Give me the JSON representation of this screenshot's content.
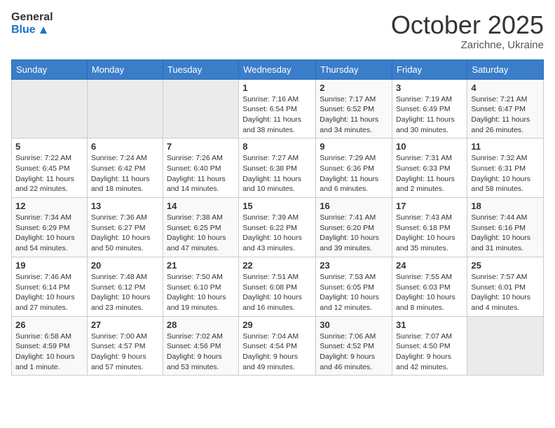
{
  "header": {
    "logo_line1": "General",
    "logo_line2": "Blue",
    "month": "October 2025",
    "location": "Zarichne, Ukraine"
  },
  "weekdays": [
    "Sunday",
    "Monday",
    "Tuesday",
    "Wednesday",
    "Thursday",
    "Friday",
    "Saturday"
  ],
  "weeks": [
    [
      {
        "day": "",
        "sunrise": "",
        "sunset": "",
        "daylight": ""
      },
      {
        "day": "",
        "sunrise": "",
        "sunset": "",
        "daylight": ""
      },
      {
        "day": "",
        "sunrise": "",
        "sunset": "",
        "daylight": ""
      },
      {
        "day": "1",
        "sunrise": "Sunrise: 7:16 AM",
        "sunset": "Sunset: 6:54 PM",
        "daylight": "Daylight: 11 hours and 38 minutes."
      },
      {
        "day": "2",
        "sunrise": "Sunrise: 7:17 AM",
        "sunset": "Sunset: 6:52 PM",
        "daylight": "Daylight: 11 hours and 34 minutes."
      },
      {
        "day": "3",
        "sunrise": "Sunrise: 7:19 AM",
        "sunset": "Sunset: 6:49 PM",
        "daylight": "Daylight: 11 hours and 30 minutes."
      },
      {
        "day": "4",
        "sunrise": "Sunrise: 7:21 AM",
        "sunset": "Sunset: 6:47 PM",
        "daylight": "Daylight: 11 hours and 26 minutes."
      }
    ],
    [
      {
        "day": "5",
        "sunrise": "Sunrise: 7:22 AM",
        "sunset": "Sunset: 6:45 PM",
        "daylight": "Daylight: 11 hours and 22 minutes."
      },
      {
        "day": "6",
        "sunrise": "Sunrise: 7:24 AM",
        "sunset": "Sunset: 6:42 PM",
        "daylight": "Daylight: 11 hours and 18 minutes."
      },
      {
        "day": "7",
        "sunrise": "Sunrise: 7:26 AM",
        "sunset": "Sunset: 6:40 PM",
        "daylight": "Daylight: 11 hours and 14 minutes."
      },
      {
        "day": "8",
        "sunrise": "Sunrise: 7:27 AM",
        "sunset": "Sunset: 6:38 PM",
        "daylight": "Daylight: 11 hours and 10 minutes."
      },
      {
        "day": "9",
        "sunrise": "Sunrise: 7:29 AM",
        "sunset": "Sunset: 6:36 PM",
        "daylight": "Daylight: 11 hours and 6 minutes."
      },
      {
        "day": "10",
        "sunrise": "Sunrise: 7:31 AM",
        "sunset": "Sunset: 6:33 PM",
        "daylight": "Daylight: 11 hours and 2 minutes."
      },
      {
        "day": "11",
        "sunrise": "Sunrise: 7:32 AM",
        "sunset": "Sunset: 6:31 PM",
        "daylight": "Daylight: 10 hours and 58 minutes."
      }
    ],
    [
      {
        "day": "12",
        "sunrise": "Sunrise: 7:34 AM",
        "sunset": "Sunset: 6:29 PM",
        "daylight": "Daylight: 10 hours and 54 minutes."
      },
      {
        "day": "13",
        "sunrise": "Sunrise: 7:36 AM",
        "sunset": "Sunset: 6:27 PM",
        "daylight": "Daylight: 10 hours and 50 minutes."
      },
      {
        "day": "14",
        "sunrise": "Sunrise: 7:38 AM",
        "sunset": "Sunset: 6:25 PM",
        "daylight": "Daylight: 10 hours and 47 minutes."
      },
      {
        "day": "15",
        "sunrise": "Sunrise: 7:39 AM",
        "sunset": "Sunset: 6:22 PM",
        "daylight": "Daylight: 10 hours and 43 minutes."
      },
      {
        "day": "16",
        "sunrise": "Sunrise: 7:41 AM",
        "sunset": "Sunset: 6:20 PM",
        "daylight": "Daylight: 10 hours and 39 minutes."
      },
      {
        "day": "17",
        "sunrise": "Sunrise: 7:43 AM",
        "sunset": "Sunset: 6:18 PM",
        "daylight": "Daylight: 10 hours and 35 minutes."
      },
      {
        "day": "18",
        "sunrise": "Sunrise: 7:44 AM",
        "sunset": "Sunset: 6:16 PM",
        "daylight": "Daylight: 10 hours and 31 minutes."
      }
    ],
    [
      {
        "day": "19",
        "sunrise": "Sunrise: 7:46 AM",
        "sunset": "Sunset: 6:14 PM",
        "daylight": "Daylight: 10 hours and 27 minutes."
      },
      {
        "day": "20",
        "sunrise": "Sunrise: 7:48 AM",
        "sunset": "Sunset: 6:12 PM",
        "daylight": "Daylight: 10 hours and 23 minutes."
      },
      {
        "day": "21",
        "sunrise": "Sunrise: 7:50 AM",
        "sunset": "Sunset: 6:10 PM",
        "daylight": "Daylight: 10 hours and 19 minutes."
      },
      {
        "day": "22",
        "sunrise": "Sunrise: 7:51 AM",
        "sunset": "Sunset: 6:08 PM",
        "daylight": "Daylight: 10 hours and 16 minutes."
      },
      {
        "day": "23",
        "sunrise": "Sunrise: 7:53 AM",
        "sunset": "Sunset: 6:05 PM",
        "daylight": "Daylight: 10 hours and 12 minutes."
      },
      {
        "day": "24",
        "sunrise": "Sunrise: 7:55 AM",
        "sunset": "Sunset: 6:03 PM",
        "daylight": "Daylight: 10 hours and 8 minutes."
      },
      {
        "day": "25",
        "sunrise": "Sunrise: 7:57 AM",
        "sunset": "Sunset: 6:01 PM",
        "daylight": "Daylight: 10 hours and 4 minutes."
      }
    ],
    [
      {
        "day": "26",
        "sunrise": "Sunrise: 6:58 AM",
        "sunset": "Sunset: 4:59 PM",
        "daylight": "Daylight: 10 hours and 1 minute."
      },
      {
        "day": "27",
        "sunrise": "Sunrise: 7:00 AM",
        "sunset": "Sunset: 4:57 PM",
        "daylight": "Daylight: 9 hours and 57 minutes."
      },
      {
        "day": "28",
        "sunrise": "Sunrise: 7:02 AM",
        "sunset": "Sunset: 4:56 PM",
        "daylight": "Daylight: 9 hours and 53 minutes."
      },
      {
        "day": "29",
        "sunrise": "Sunrise: 7:04 AM",
        "sunset": "Sunset: 4:54 PM",
        "daylight": "Daylight: 9 hours and 49 minutes."
      },
      {
        "day": "30",
        "sunrise": "Sunrise: 7:06 AM",
        "sunset": "Sunset: 4:52 PM",
        "daylight": "Daylight: 9 hours and 46 minutes."
      },
      {
        "day": "31",
        "sunrise": "Sunrise: 7:07 AM",
        "sunset": "Sunset: 4:50 PM",
        "daylight": "Daylight: 9 hours and 42 minutes."
      },
      {
        "day": "",
        "sunrise": "",
        "sunset": "",
        "daylight": ""
      }
    ]
  ]
}
